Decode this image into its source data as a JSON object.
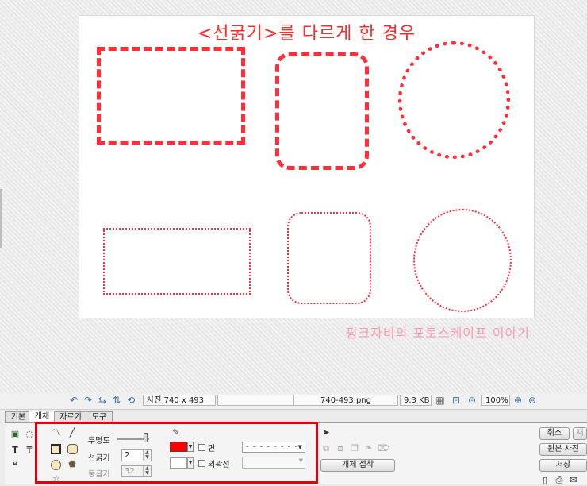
{
  "canvas": {
    "title": "<선굵기>를 다르게 한 경우",
    "watermark": "핑크자비의 포토스케이프 이야기"
  },
  "statusbar": {
    "photo_size": "사진 740 x 493",
    "filename": "740-493.png",
    "filesize": "9.3 KB",
    "zoom": "100%"
  },
  "tabs": [
    {
      "label": "기본"
    },
    {
      "label": "개체"
    },
    {
      "label": "자르기"
    },
    {
      "label": "도구"
    }
  ],
  "object_panel": {
    "opacity_label": "투명도",
    "stroke_width_label": "선굵기",
    "stroke_width_value": "2",
    "corner_label": "둥글기",
    "corner_value": "32",
    "fill_label": "면",
    "outline_label": "외곽선",
    "dash_style": "- - - - - - - -",
    "line_color": "#ff0000",
    "group_button": "개체 접착"
  },
  "right_buttons": {
    "cancel": "취소",
    "redo": "재",
    "original": "원본 사진",
    "save": "저장"
  }
}
